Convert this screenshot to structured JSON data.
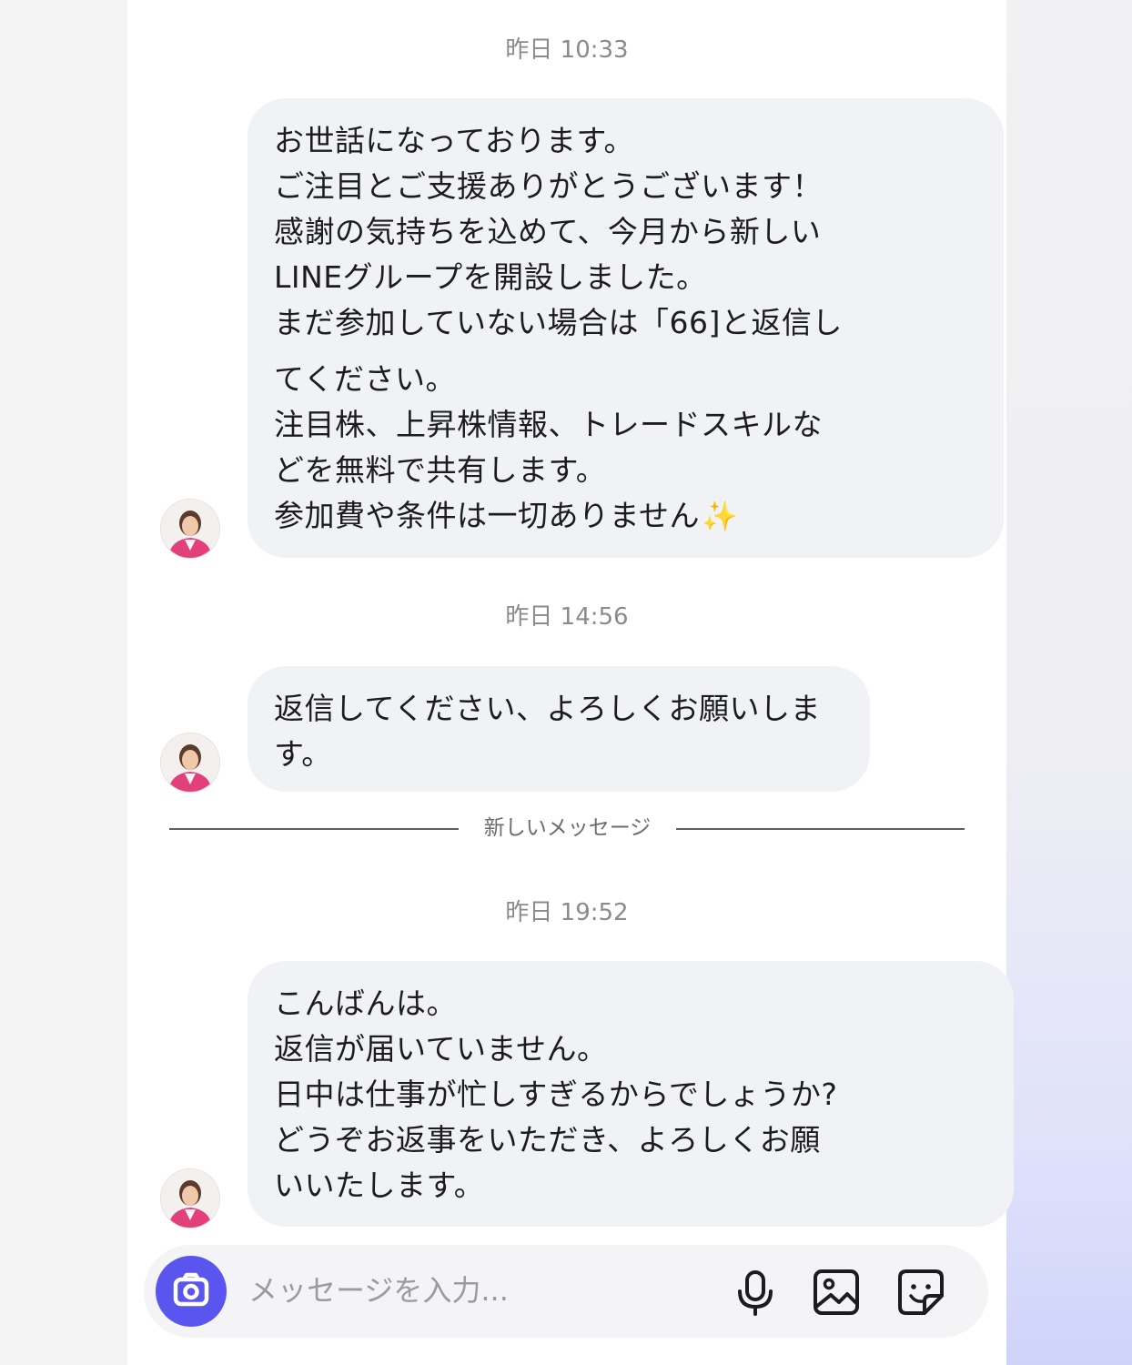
{
  "messages": [
    {
      "timestamp": "昨日 10:33",
      "lines": [
        "お世話になっております。",
        "ご注目とご支援ありがとうございます！",
        "感謝の気持ちを込めて、今月から新しい",
        "LINEグループを開設しました。",
        "まだ参加していない場合は「66]と返信し",
        "てください。",
        "注目株、上昇株情報、トレードスキルな",
        "どを無料で共有します。",
        "参加費や条件は一切ありません"
      ],
      "emoji": "✨"
    },
    {
      "timestamp": "昨日 14:56",
      "lines": [
        "返信してください、よろしくお願いしま",
        "す。"
      ]
    },
    {
      "timestamp": "昨日 19:52",
      "lines": [
        "こんばんは。",
        "返信が届いていません。",
        "日中は仕事が忙しすぎるからでしょうか?",
        "どうぞお返事をいただき、よろしくお願",
        "いいたします。"
      ]
    }
  ],
  "divider": {
    "label": "新しいメッセージ"
  },
  "composer": {
    "placeholder": "メッセージを入力...",
    "icons": {
      "camera": "camera-icon",
      "mic": "microphone-icon",
      "image": "image-icon",
      "sticker": "sticker-icon"
    }
  },
  "colors": {
    "accent": "#5b55f0",
    "bubble": "#f1f2f5",
    "timestamp": "#8a8a8f",
    "text": "#1c1c1e"
  }
}
